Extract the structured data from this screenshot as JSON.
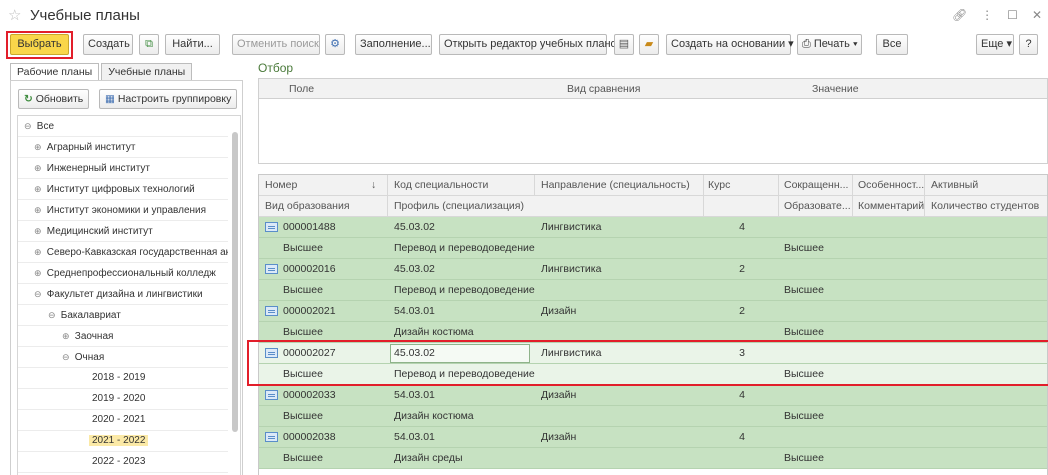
{
  "window": {
    "title": "Учебные планы",
    "icons": [
      "link-icon",
      "more-icon",
      "maximize-icon",
      "close-icon"
    ]
  },
  "toolbar": {
    "select": "Выбрать",
    "create": "Создать",
    "find": "Найти...",
    "cancel_search": "Отменить поиск",
    "fill": "Заполнение...",
    "open_editor": "Открыть редактор учебных планов",
    "create_based": "Создать на основании ▾",
    "print": "Печать ▾",
    "all": "Все",
    "more": "Еще ▾",
    "help": "?"
  },
  "tabs": [
    "Рабочие планы",
    "Учебные планы"
  ],
  "left_panel": {
    "refresh": "Обновить",
    "grouping": "Настроить группировку"
  },
  "tree": [
    {
      "label": "Все",
      "exp": "⊖"
    },
    {
      "label": "Аграрный институт",
      "exp": "⊕"
    },
    {
      "label": "Инженерный институт",
      "exp": "⊕"
    },
    {
      "label": "Институт цифровых технологий",
      "exp": "⊕"
    },
    {
      "label": "Институт экономики и управления",
      "exp": "⊕"
    },
    {
      "label": "Медицинский институт",
      "exp": "⊕"
    },
    {
      "label": "Северо-Кавказская государственная академия",
      "exp": "⊕"
    },
    {
      "label": "Среднепрофессиональный колледж",
      "exp": "⊕"
    },
    {
      "label": "Факультет дизайна и лингвистики",
      "exp": "⊖"
    },
    {
      "label": "Бакалавриат",
      "exp": "⊖"
    },
    {
      "label": "Заочная",
      "exp": "⊕"
    },
    {
      "label": "Очная",
      "exp": "⊖"
    },
    {
      "label": "2018 - 2019",
      "exp": ""
    },
    {
      "label": "2019 - 2020",
      "exp": ""
    },
    {
      "label": "2020 - 2021",
      "exp": ""
    },
    {
      "label": "2021 - 2022",
      "exp": ""
    },
    {
      "label": "2022 - 2023",
      "exp": ""
    }
  ],
  "filter": {
    "label": "Отбор",
    "columns": [
      "Поле",
      "Вид сравнения",
      "Значение"
    ]
  },
  "grid": {
    "header1": [
      "Номер",
      "↓",
      "Код специальности",
      "Направление (специальность)",
      "Курс",
      "Сокращенн...",
      "Особенност...",
      "Активный"
    ],
    "header2": [
      "Вид образования",
      "Профиль (специализация)",
      "Образовате...",
      "Комментарий",
      "Количество студентов"
    ],
    "rows": [
      {
        "number": "000001488",
        "code": "45.03.02",
        "direction": "Лингвистика",
        "course": "4",
        "kind": "Высшее",
        "profile": "Перевод и переводоведение",
        "edu": "Высшее"
      },
      {
        "number": "000002016",
        "code": "45.03.02",
        "direction": "Лингвистика",
        "course": "2",
        "kind": "Высшее",
        "profile": "Перевод и переводоведение",
        "edu": "Высшее"
      },
      {
        "number": "000002021",
        "code": "54.03.01",
        "direction": "Дизайн",
        "course": "2",
        "kind": "Высшее",
        "profile": "Дизайн костюма",
        "edu": "Высшее"
      },
      {
        "number": "000002027",
        "code": "45.03.02",
        "direction": "Лингвистика",
        "course": "3",
        "kind": "Высшее",
        "profile": "Перевод и переводоведение",
        "edu": "Высшее"
      },
      {
        "number": "000002033",
        "code": "54.03.01",
        "direction": "Дизайн",
        "course": "4",
        "kind": "Высшее",
        "profile": "Дизайн костюма",
        "edu": "Высшее"
      },
      {
        "number": "000002038",
        "code": "54.03.01",
        "direction": "Дизайн",
        "course": "4",
        "kind": "Высшее",
        "profile": "Дизайн среды",
        "edu": "Высшее"
      }
    ]
  },
  "colors": {
    "highlight": "#e21e2a",
    "row_green": "#c7e2c2",
    "primary": "#f9d64a"
  }
}
